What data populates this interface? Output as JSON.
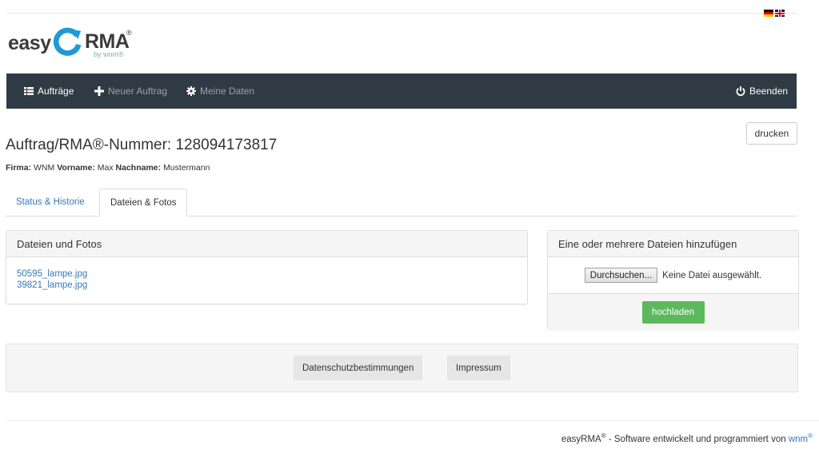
{
  "header": {
    "languages": [
      "de",
      "en"
    ],
    "logo": {
      "part1": "easy",
      "part2": "RMA",
      "mark": "®",
      "byline": "by wnm®"
    }
  },
  "nav": {
    "items": [
      {
        "label": "Aufträge",
        "icon": "list-icon",
        "active": true
      },
      {
        "label": "Neuer Auftrag",
        "icon": "plus-icon",
        "active": false
      },
      {
        "label": "Meine Daten",
        "icon": "gear-icon",
        "active": false
      }
    ],
    "logout": {
      "label": "Beenden",
      "icon": "power-icon"
    }
  },
  "page": {
    "print_label": "drucken",
    "title": "Auftrag/RMA®-Nummer: 128094173817",
    "meta": [
      {
        "key": "Firma:",
        "value": "WNM"
      },
      {
        "key": "Vorname:",
        "value": "Max"
      },
      {
        "key": "Nachname:",
        "value": "Mustermann"
      }
    ]
  },
  "tabs": [
    {
      "label": "Status & Historie",
      "active": false
    },
    {
      "label": "Dateien & Fotos",
      "active": true
    }
  ],
  "files_panel": {
    "heading": "Dateien und Fotos",
    "files": [
      "50595_lampe.jpg",
      "39821_lampe.jpg"
    ]
  },
  "upload_panel": {
    "heading": "Eine oder mehrere Dateien hinzufügen",
    "browse_label": "Durchsuchen...",
    "no_file_text": "Keine Datei ausgewählt.",
    "upload_label": "hochladen"
  },
  "footer": {
    "privacy_label": "Datenschutzbestimmungen",
    "imprint_label": "Impressum",
    "credits_brand": "easyRMA",
    "credits_mark": "®",
    "credits_text": " - Software entwickelt und programmiert von ",
    "credits_link": "wnm",
    "credits_link_mark": "®"
  },
  "colors": {
    "navbar": "#2f3a45",
    "link": "#337ab7",
    "success": "#5cb85c",
    "logo_ring": "#1e9ad6"
  }
}
